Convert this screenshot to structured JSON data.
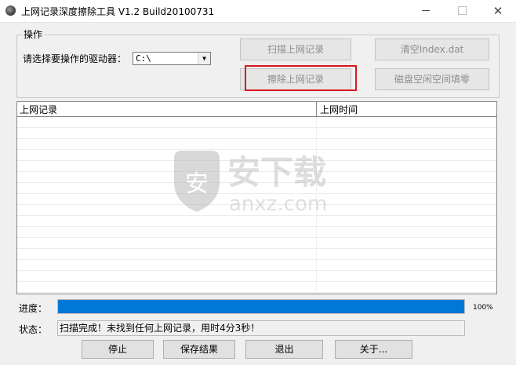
{
  "window": {
    "title": "上网记录深度擦除工具 V1.2   Build20100731",
    "minimize_icon": "minimize-icon",
    "maximize_icon": "maximize-icon",
    "close_icon": "close-icon"
  },
  "operation": {
    "group_title": "操作",
    "drive_label": "请选择要操作的驱动器：",
    "drive_value": "C:\\",
    "scan_label": "扫描上网记录",
    "erase_label": "擦除上网记录",
    "clear_index_label": "清空Index.dat",
    "wipe_free_space_label": "磁盘空闲空间填零"
  },
  "records_list": {
    "columns": [
      "上网记录",
      "上网时间"
    ],
    "rows": []
  },
  "watermark": {
    "text": "安下载",
    "sub": "anxz.com",
    "badge": "安"
  },
  "progress": {
    "label": "进度：",
    "percent": "100%",
    "value": 1.0
  },
  "status": {
    "label": "状态：",
    "text": "扫描完成！未找到任何上网记录，用时4分3秒！"
  },
  "buttons": {
    "stop": "停止",
    "save": "保存结果",
    "exit": "退出",
    "about": "关于..."
  },
  "colors": {
    "progress": "#0078d7",
    "highlight": "#d9161c"
  }
}
